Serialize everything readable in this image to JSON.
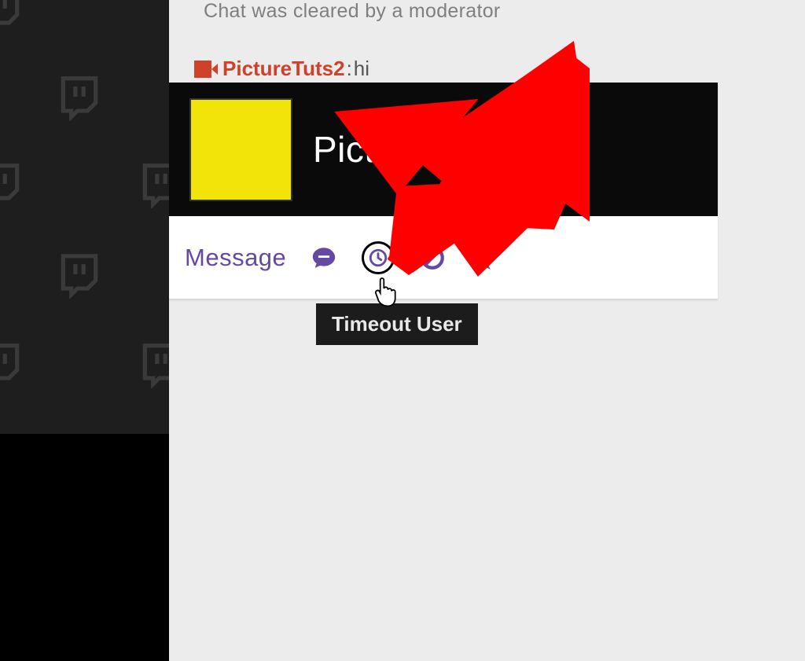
{
  "chat": {
    "notice": "Chat was cleared by a moderator",
    "message": {
      "username": "PictureTuts2",
      "separator": ":",
      "text": "hi"
    }
  },
  "usercard": {
    "display_name": "Picture",
    "actions": {
      "message_label": "Message"
    }
  },
  "tooltip": {
    "timeout": "Timeout User"
  },
  "colors": {
    "accent": "#6448a3",
    "avatar": "#f2e308",
    "username": "#d0412a",
    "arrow": "#ff0000"
  }
}
